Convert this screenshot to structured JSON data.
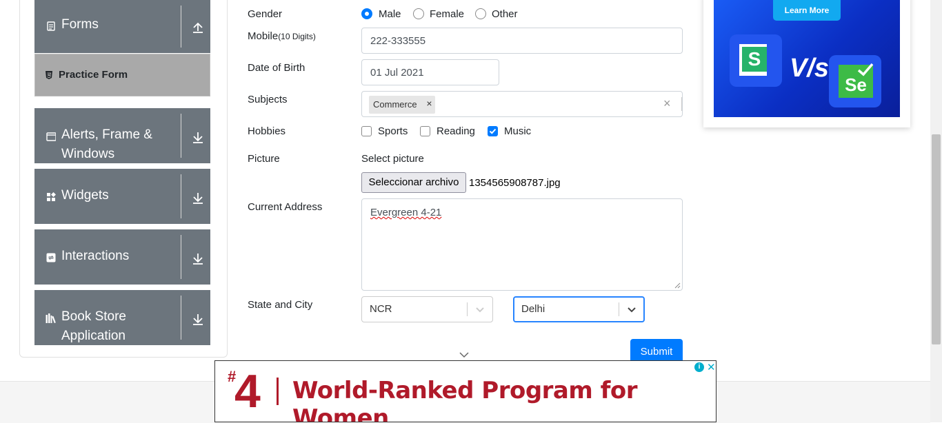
{
  "sidebar": {
    "forms": {
      "label": "Forms",
      "icon": "document-icon",
      "chevron": "chevron-up-icon"
    },
    "active_item": {
      "label": "Practice Form",
      "icon": "html5-icon"
    },
    "groups": [
      {
        "label_line1": "Alerts, Frame &",
        "label_line2": "Windows",
        "icon": "window-icon"
      },
      {
        "label_line1": "Widgets",
        "icon": "widgets-icon"
      },
      {
        "label_line1": "Interactions",
        "icon": "interactions-icon"
      },
      {
        "label_line1": "Book Store",
        "label_line2": "Application",
        "icon": "books-icon"
      }
    ]
  },
  "form": {
    "gender": {
      "label": "Gender",
      "options": [
        "Male",
        "Female",
        "Other"
      ],
      "selected": "Male"
    },
    "mobile": {
      "label": "Mobile",
      "hint": "(10 Digits)",
      "value": "222-333555"
    },
    "dob": {
      "label": "Date of Birth",
      "value": "01 Jul 2021"
    },
    "subjects": {
      "label": "Subjects",
      "chip": "Commerce",
      "chip_remove": "×",
      "clear": "×"
    },
    "hobbies": {
      "label": "Hobbies",
      "options": [
        "Sports",
        "Reading",
        "Music"
      ],
      "checked": [
        "Music"
      ]
    },
    "picture": {
      "label": "Picture",
      "caption": "Select picture",
      "button": "Seleccionar archivo",
      "filename": "1354565908787.jpg"
    },
    "address": {
      "label": "Current Address",
      "value": "Evergreen 4-21"
    },
    "state_city": {
      "label": "State and City",
      "state": "NCR",
      "city": "Delhi"
    },
    "submit": "Submit"
  },
  "side_ad": {
    "button": "Learn More",
    "vs": "V/s",
    "left_logo": "S",
    "right_logo": "Se"
  },
  "bottom_ad": {
    "hash": "#",
    "number": "4",
    "text": "World-Ranked Program for Women",
    "info": "i",
    "close": "✕"
  },
  "colors": {
    "primary": "#007bff",
    "sidebar_group": "#6c757d",
    "sidebar_active": "#a9a9a9",
    "ad_red": "#b01a2a",
    "ad_blue": "#0b2fc4"
  }
}
